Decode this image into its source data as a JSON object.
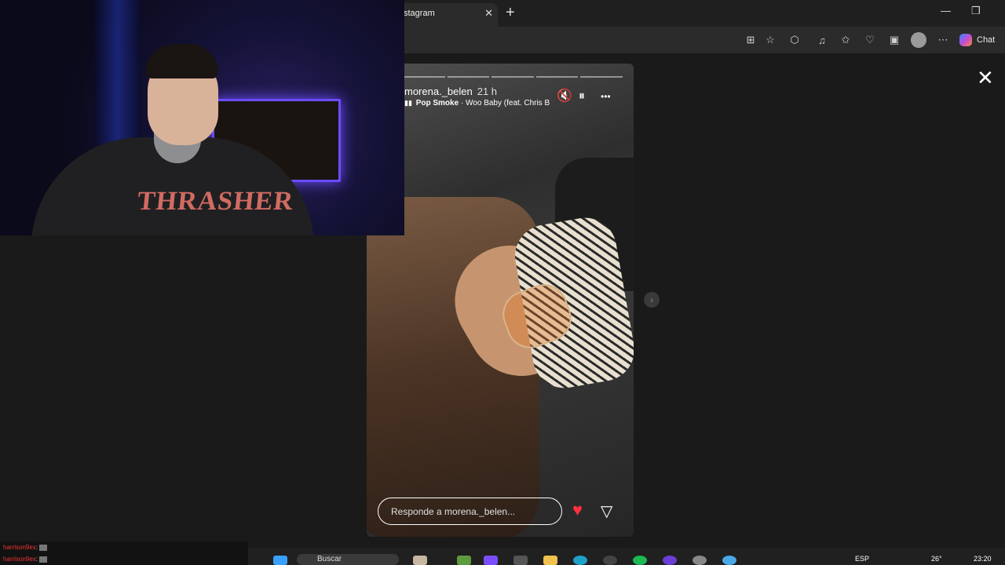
{
  "browser": {
    "tab_title": "stagram",
    "tab_close": "✕",
    "new_tab": "+",
    "window_controls": [
      "—",
      "❐"
    ],
    "toolbar_icons": [
      "apps-icon",
      "favorite-icon",
      "extensions-icon",
      "reading-list-icon",
      "favorites-bar-icon",
      "health-icon",
      "screenshot-icon",
      "profile-icon",
      "more-icon"
    ],
    "chat_label": "Chat"
  },
  "viewer": {
    "close": "✕",
    "next": "›"
  },
  "story": {
    "username": "morena._belen",
    "time": "21 h",
    "song_artist": "Pop Smoke",
    "song_title": "· Woo Baby (feat. Chris Br",
    "mute_icon": "🔇",
    "pause_icon": "⏸",
    "more_icon": "•••",
    "reply_placeholder": "Responde a morena._belen...",
    "like_icon": "♥",
    "share_icon": "▽",
    "segments": 5
  },
  "webcam": {
    "shirt_print": "THRASHER"
  },
  "chat": {
    "lines": [
      {
        "user": "harrison9ex",
        "sep": ":"
      },
      {
        "user": "harrison9ex",
        "sep": ":"
      }
    ]
  },
  "taskbar": {
    "search_placeholder": "Buscar",
    "language": "ESP",
    "temperature": "26°",
    "time": "23:20",
    "colors": {
      "start": "#3aa0ff",
      "edge": "#1fa0c8",
      "spotify": "#1db954",
      "folder": "#f2c14e"
    }
  }
}
